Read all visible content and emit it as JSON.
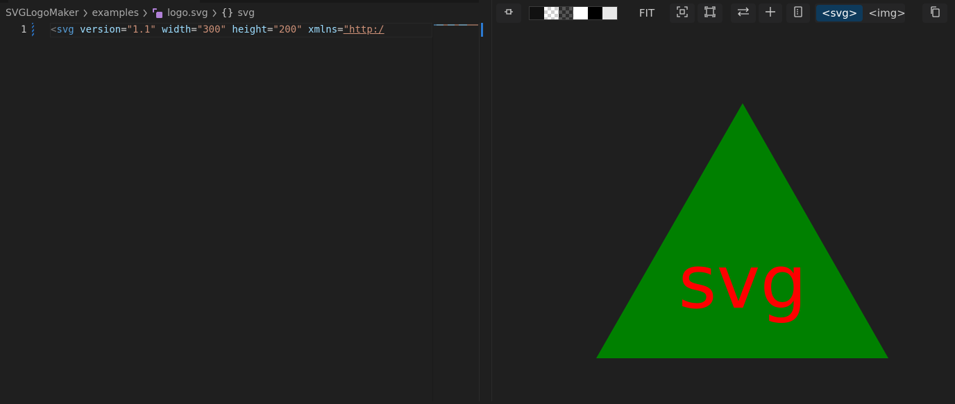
{
  "editor": {
    "breadcrumb": [
      {
        "label": "SVGLogoMaker",
        "kind": "folder"
      },
      {
        "label": "examples",
        "kind": "folder"
      },
      {
        "label": "logo.svg",
        "kind": "file",
        "icon": "svg-file-icon"
      },
      {
        "label": "svg",
        "kind": "symbol",
        "icon": "braces-icon"
      }
    ],
    "line_number": "1",
    "code": {
      "open": "<",
      "tag": "svg",
      "attrs": [
        {
          "name": "version",
          "value": "\"1.1\""
        },
        {
          "name": "width",
          "value": "\"300\""
        },
        {
          "name": "height",
          "value": "\"200\""
        },
        {
          "name": "xmlns",
          "value": "\"http:/"
        }
      ]
    }
  },
  "preview": {
    "toolbar": {
      "pin_icon": "pin-icon",
      "background_swatches": [
        "#111111",
        "checker-light",
        "checker-dark",
        "#ffffff",
        "#000000",
        "#e8e8e8"
      ],
      "fit_label": "FIT",
      "zoom_icons": [
        "fit-width-icon",
        "fit-page-icon"
      ],
      "action_icons": [
        "swap-icon",
        "plus-icon",
        "document-icon"
      ],
      "tabs": [
        {
          "label": "<svg>",
          "active": true
        },
        {
          "label": "<img>",
          "active": false
        }
      ],
      "copy_icon": "copy-icon"
    },
    "render": {
      "shape": "triangle",
      "fill": "#008000",
      "text": "svg",
      "text_color": "#ff0000"
    }
  },
  "colors": {
    "background": "#1f1f1f",
    "active_tab": "#0e3a5b",
    "accent": "#2b79d0"
  }
}
